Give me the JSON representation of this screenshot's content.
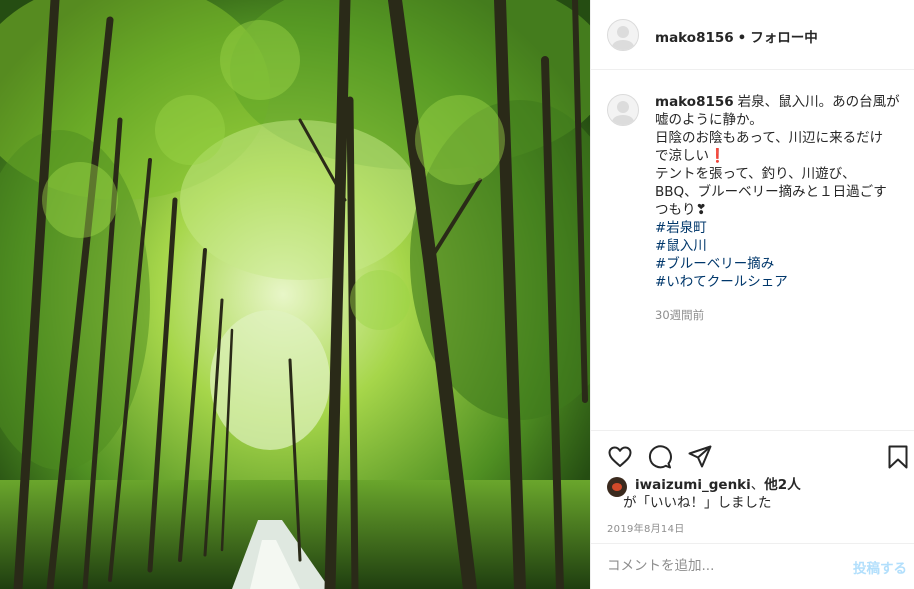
{
  "post": {
    "photo_alt": "森の中の木漏れ日の小道",
    "header": {
      "username": "mako8156",
      "separator": "•",
      "follow_status": "フォロー中"
    },
    "caption": {
      "username": "mako8156",
      "line1": "岩泉、鼠入川。あの台風が",
      "line2": "嘘のように静か。",
      "line3": "日陰のお陰もあって、川辺に来るだけ",
      "line4a": "で涼しい",
      "line4b": "❗",
      "line5": "テントを張って、釣り、川遊び、",
      "line6": "BBQ、ブルーベリー摘みと１日過ごす",
      "line7": "つもり❣",
      "hashtags": [
        "#岩泉町",
        "#鼠入川",
        "#ブルーベリー摘み",
        "#いわてクールシェア"
      ]
    },
    "time_ago": "30週間前",
    "likes": {
      "liker": "iwaizumi_genki",
      "others_sep": "、",
      "others": "他2人",
      "line2": "が「いいね！」しました"
    },
    "date": "2019年8月14日",
    "comment": {
      "placeholder": "コメントを追加...",
      "post_label": "投稿する"
    },
    "icons": {
      "like": "heart-icon",
      "comment": "comment-icon",
      "share": "paper-plane-icon",
      "save": "bookmark-icon"
    }
  }
}
